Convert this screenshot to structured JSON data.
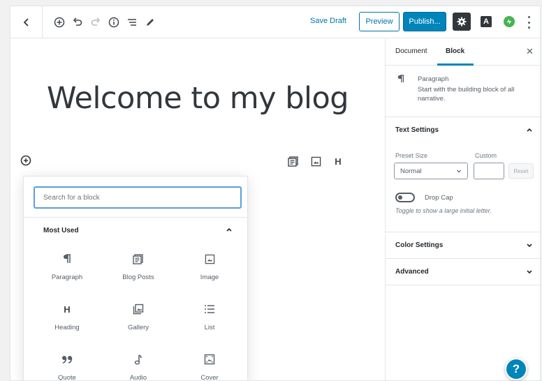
{
  "toolbar": {
    "save_draft": "Save Draft",
    "preview": "Preview",
    "publish": "Publish...",
    "avatar_letter": "A"
  },
  "editor": {
    "title": "Welcome to my blog",
    "block_toolbar": {
      "heading_label": "H"
    }
  },
  "inserter": {
    "search_placeholder": "Search for a block",
    "section_title": "Most Used",
    "blocks": [
      {
        "label": "Paragraph",
        "icon": "paragraph-icon"
      },
      {
        "label": "Blog Posts",
        "icon": "blog-posts-icon"
      },
      {
        "label": "Image",
        "icon": "image-icon"
      },
      {
        "label": "Heading",
        "icon": "heading-icon"
      },
      {
        "label": "Gallery",
        "icon": "gallery-icon"
      },
      {
        "label": "List",
        "icon": "list-icon"
      },
      {
        "label": "Quote",
        "icon": "quote-icon"
      },
      {
        "label": "Audio",
        "icon": "audio-icon"
      },
      {
        "label": "Cover",
        "icon": "cover-icon"
      }
    ]
  },
  "sidebar": {
    "tabs": {
      "document": "Document",
      "block": "Block"
    },
    "block_card": {
      "title": "Paragraph",
      "description": "Start with the building block of all narrative."
    },
    "text_settings": {
      "title": "Text Settings",
      "preset_label": "Preset Size",
      "custom_label": "Custom",
      "preset_value": "Normal",
      "reset": "Reset",
      "drop_cap_label": "Drop Cap",
      "drop_cap_help": "Toggle to show a large initial letter."
    },
    "color_settings": {
      "title": "Color Settings"
    },
    "advanced": {
      "title": "Advanced"
    }
  },
  "colors": {
    "accent": "#0085ba",
    "link": "#0073aa",
    "dark": "#32373c",
    "green": "#46b450"
  }
}
